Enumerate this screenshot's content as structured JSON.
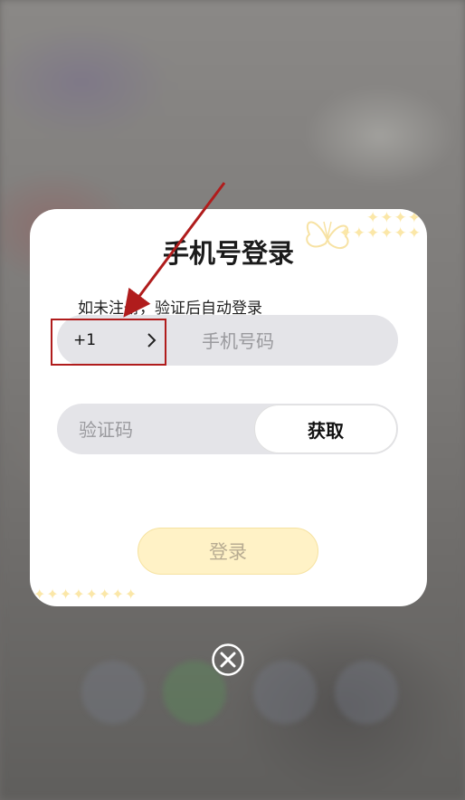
{
  "modal": {
    "title": "手机号登录",
    "hint": "如未注册，验证后自动登录",
    "country_code": "+1",
    "phone_placeholder": "手机号码",
    "code_placeholder": "验证码",
    "get_code_label": "获取",
    "login_label": "登录",
    "sparkles_top_row1": "✦✦✦✦",
    "sparkles_top_row2": "✦✦✦✦✦✦",
    "sparkles_bottom": "✦✦✦✦✦✦✦✦"
  },
  "icons": {
    "chevron": "chevron-right-icon",
    "close": "close-circle-icon",
    "decoration": "butterfly-icon"
  },
  "colors": {
    "login_bg": "#fff2c6",
    "input_bg": "#e4e4e8",
    "annotation": "#b01c1c",
    "sparkle": "#fbe7a8"
  }
}
